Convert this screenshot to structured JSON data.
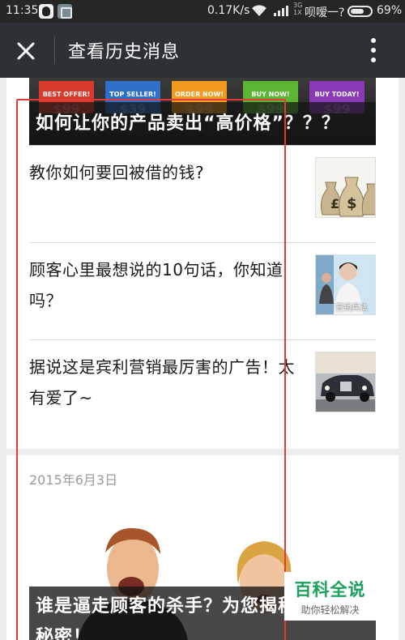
{
  "status_bar": {
    "time": "11:35",
    "speed": "0.17K/s",
    "net_type": "3G",
    "net_sub": "1X",
    "carrier": "呗嗳一?",
    "battery": "69%",
    "battery_level": 0.69
  },
  "app_bar": {
    "title": "查看历史消息",
    "close_icon": "close-icon",
    "more_icon": "more-vertical-icon"
  },
  "card1": {
    "hero": {
      "title": "如何让你的产品卖出“高价格”？？？",
      "tags": [
        {
          "label": "BEST OFFER!",
          "price": "$99",
          "color": "#d93a2b"
        },
        {
          "label": "TOP SELLER!",
          "price": "$39",
          "color": "#2f6fc9"
        },
        {
          "label": "ORDER NOW!",
          "price": "$99",
          "color": "#f29a1d"
        },
        {
          "label": "BUY NOW!",
          "price": "$99",
          "color": "#5bb532"
        },
        {
          "label": "BUY TODAY!",
          "price": "$99",
          "color": "#8a3ab9"
        }
      ]
    },
    "items": [
      {
        "title": "教你如何要回被借的钱?"
      },
      {
        "title": "顾客心里最想说的10句话，你知道吗？",
        "thumb_caption": "营销兵法"
      },
      {
        "title": "据说这是宾利营销最厉害的广告！太有爱了~"
      }
    ]
  },
  "card2": {
    "date": "2015年6月3日",
    "hero_title": "谁是逼走顾客的杀手？为您揭秘成交的秘密！"
  },
  "watermark": {
    "brand": "百科全说",
    "slogan": "助你轻松解决"
  }
}
